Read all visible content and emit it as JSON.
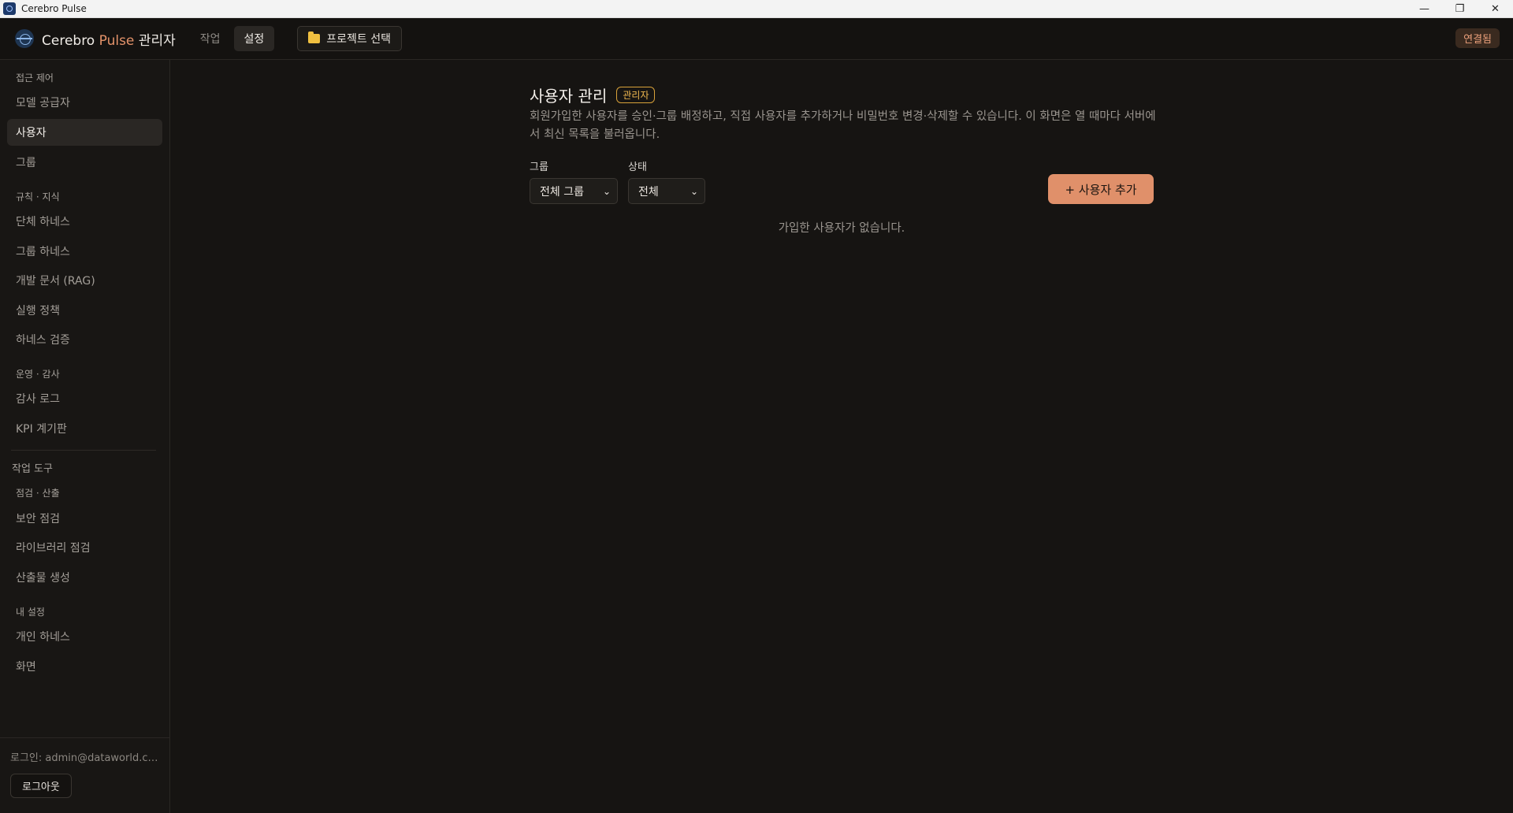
{
  "window": {
    "title": "Cerebro Pulse",
    "minimize": "—",
    "restore": "❐",
    "close": "✕"
  },
  "header": {
    "brand_main": "Cerebro",
    "brand_pulse": "Pulse",
    "brand_suffix": "관리자",
    "tabs": [
      {
        "label": "작업"
      },
      {
        "label": "설정"
      }
    ],
    "project_button": "프로젝트 선택",
    "connection_status": "연결됨"
  },
  "sidebar": {
    "sections": {
      "access": "접근 제어",
      "rules": "규칙 · 지식",
      "ops": "운영 · 감사",
      "tools_group": "작업 도구",
      "check": "점검 · 산출",
      "mine": "내 설정"
    },
    "items": [
      {
        "label": "모델 공급자"
      },
      {
        "label": "사용자"
      },
      {
        "label": "그룹"
      },
      {
        "label": "단체 하네스"
      },
      {
        "label": "그룹 하네스"
      },
      {
        "label": "개발 문서 (RAG)"
      },
      {
        "label": "실행 정책"
      },
      {
        "label": "하네스 검증"
      },
      {
        "label": "감사 로그"
      },
      {
        "label": "KPI 계기판"
      },
      {
        "label": "보안 점검"
      },
      {
        "label": "라이브러리 점검"
      },
      {
        "label": "산출물 생성"
      },
      {
        "label": "개인 하네스"
      },
      {
        "label": "화면"
      }
    ],
    "login_info": "로그인: admin@dataworld.co....",
    "logout": "로그아웃"
  },
  "main": {
    "title": "사용자 관리",
    "badge": "관리자",
    "description": "회원가입한 사용자를 승인·그룹 배정하고, 직접 사용자를 추가하거나 비밀번호 변경·삭제할 수 있습니다. 이 화면은 열 때마다 서버에서 최신 목록을 불러옵니다.",
    "group_label": "그룹",
    "group_value": "전체 그룹",
    "status_label": "상태",
    "status_value": "전체",
    "add_button": "+ 사용자 추가",
    "empty_message": "가입한 사용자가 없습니다."
  },
  "colors": {
    "accent": "#e0906a",
    "badge": "#f0b850",
    "background": "#161412"
  }
}
